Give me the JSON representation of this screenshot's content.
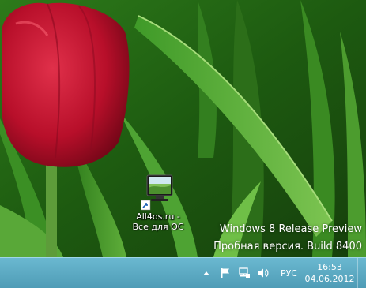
{
  "desktop": {
    "icons": [
      {
        "label_line1": "All4os.ru -",
        "label_line2": "Все для ОС",
        "icon": "monitor-shortcut-icon"
      }
    ],
    "watermark": {
      "line1": "Windows 8 Release Preview",
      "line2": "Пробная версия. Build 8400"
    }
  },
  "taskbar": {
    "tray": {
      "icons": [
        "show-hidden-icons-arrow",
        "action-center-flag-icon",
        "network-icon",
        "volume-icon"
      ],
      "language": "РУС",
      "time": "16:53",
      "date": "04.06.2012"
    }
  },
  "colors": {
    "taskbar": "#5aa8c2",
    "tulip": "#c4102e",
    "foliage": "#3f8f23"
  }
}
